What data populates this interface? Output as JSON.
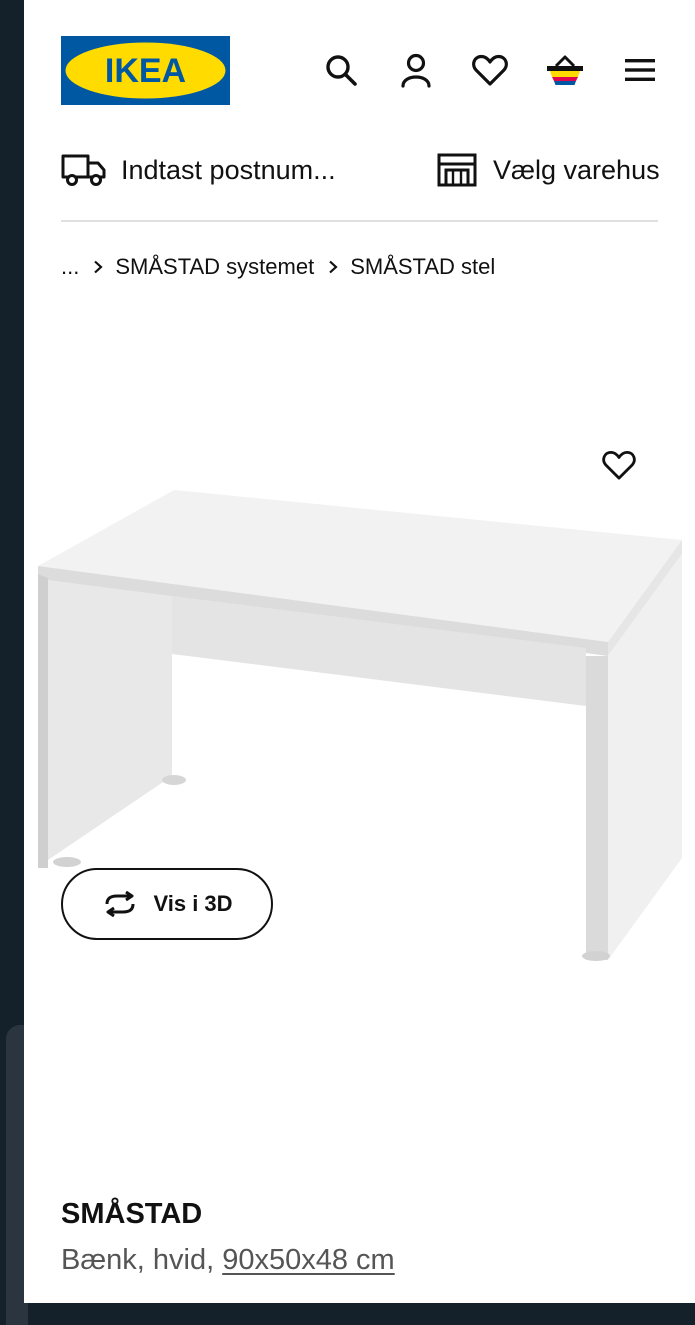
{
  "header": {
    "logo_text": "IKEA",
    "logo_colors": {
      "blue": "#0058a3",
      "yellow": "#ffdb00"
    },
    "icons": [
      "search-icon",
      "account-icon",
      "heart-icon",
      "basket-icon",
      "menu-icon"
    ]
  },
  "delivery": {
    "label": "Indtast postnum...",
    "icon": "truck-icon"
  },
  "store": {
    "label": "Vælg varehus",
    "icon": "store-icon"
  },
  "breadcrumb": {
    "items": [
      "...",
      "SMÅSTAD systemet",
      "SMÅSTAD stel"
    ]
  },
  "product": {
    "view3d_label": "Vis i 3D",
    "name": "SMÅSTAD",
    "description": "Bænk, hvid, ",
    "dimensions": "90x50x48 cm"
  }
}
